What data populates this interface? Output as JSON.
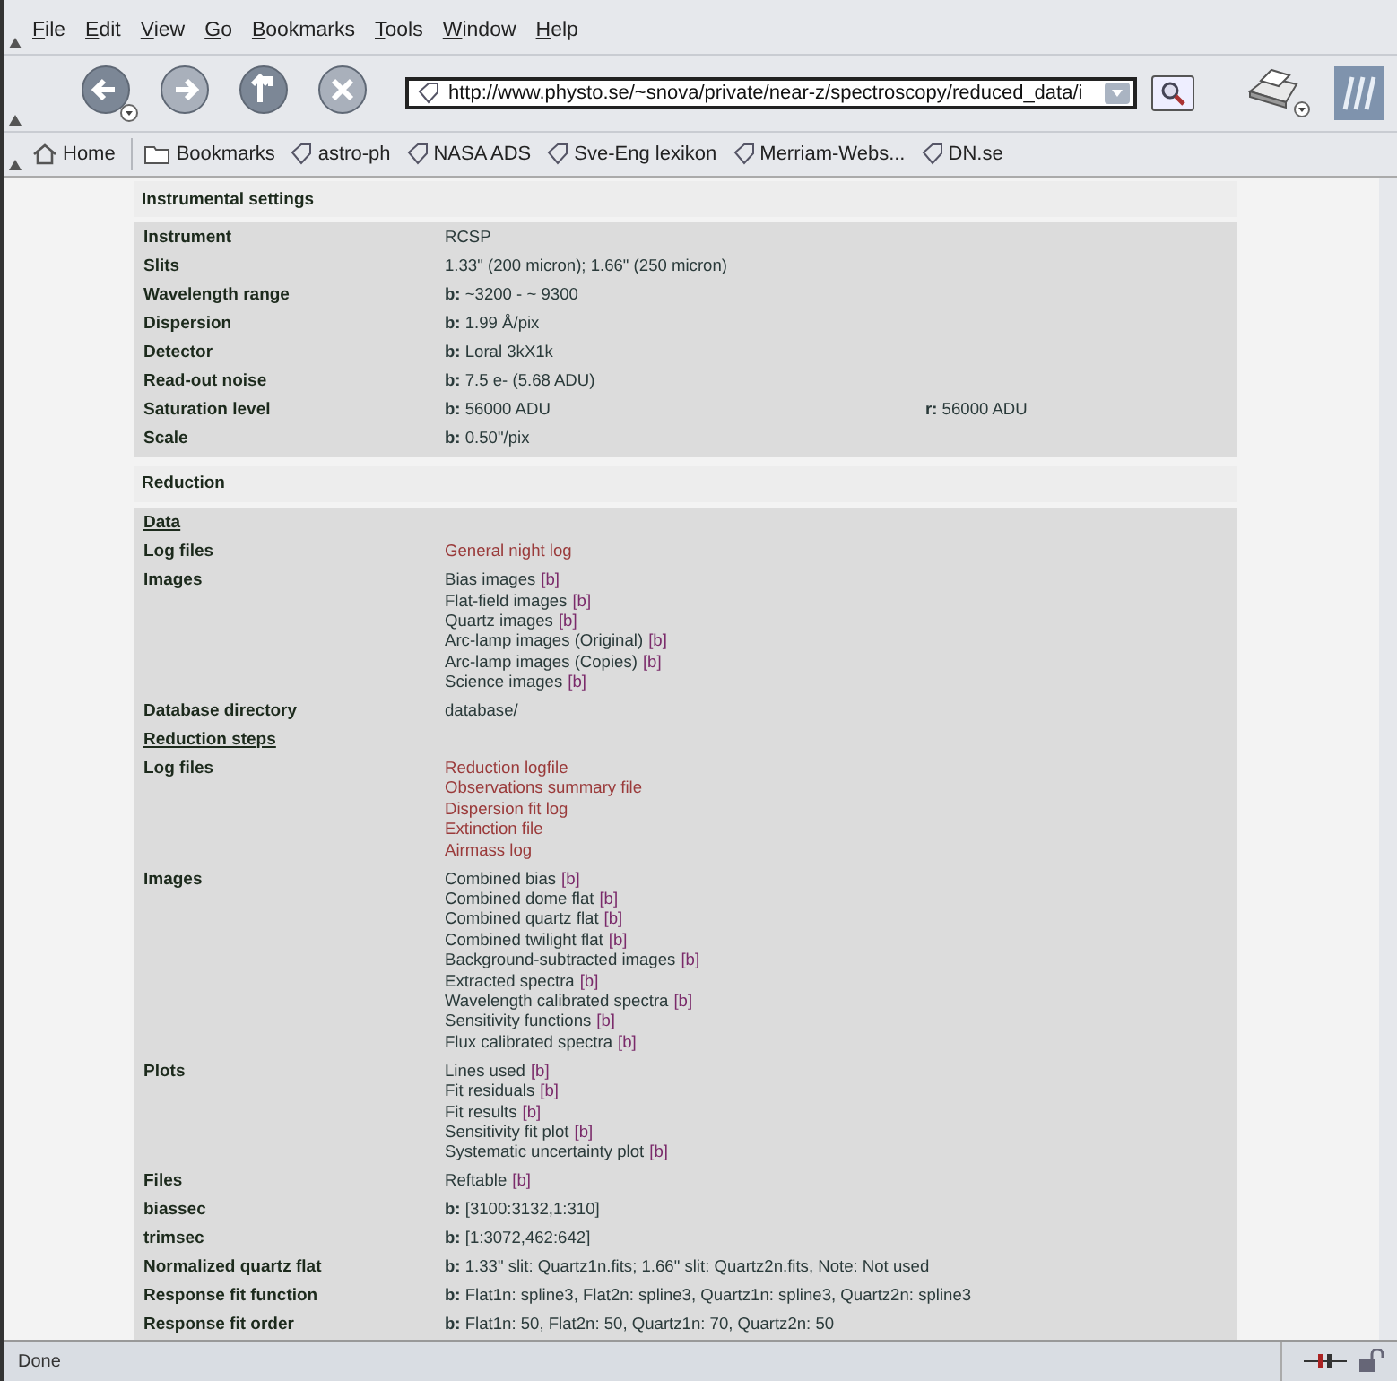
{
  "menu": [
    "File",
    "Edit",
    "View",
    "Go",
    "Bookmarks",
    "Tools",
    "Window",
    "Help"
  ],
  "nav_buttons": [
    {
      "kind": "back",
      "disabled": false
    },
    {
      "kind": "forward",
      "disabled": true
    },
    {
      "kind": "up",
      "disabled": false
    },
    {
      "kind": "stop",
      "disabled": true
    }
  ],
  "address": {
    "value": "http://www.physto.se/~snova/private/near-z/spectroscopy/reduced_data/i"
  },
  "bookmarks": [
    {
      "kind": "home",
      "label": "Home"
    },
    {
      "kind": "folder",
      "label": "Bookmarks"
    },
    {
      "kind": "link",
      "label": "astro-ph"
    },
    {
      "kind": "link",
      "label": "NASA ADS"
    },
    {
      "kind": "link",
      "label": "Sve-Eng lexikon"
    },
    {
      "kind": "link",
      "label": "Merriam-Webs..."
    },
    {
      "kind": "link",
      "label": "DN.se"
    }
  ],
  "sections": [
    {
      "title": "Instrumental settings",
      "rows": [
        {
          "label": "Instrument",
          "heading": false,
          "values": [
            {
              "kind": "text",
              "text": "RCSP"
            }
          ]
        },
        {
          "label": "Slits",
          "heading": false,
          "values": [
            {
              "kind": "text",
              "text": "1.33\" (200 micron); 1.66\" (250 micron)"
            }
          ]
        },
        {
          "label": "Wavelength range",
          "heading": false,
          "values": [
            {
              "kind": "text",
              "text": "**b:** ~3200 - ~ 9300"
            }
          ]
        },
        {
          "label": "Dispersion",
          "heading": false,
          "values": [
            {
              "kind": "text",
              "text": "**b:** 1.99 Å/pix"
            }
          ]
        },
        {
          "label": "Detector",
          "heading": false,
          "values": [
            {
              "kind": "text",
              "text": "**b:** Loral 3kX1k"
            }
          ]
        },
        {
          "label": "Read-out noise",
          "heading": false,
          "values": [
            {
              "kind": "text",
              "text": "**b:** 7.5 e- (5.68 ADU)"
            }
          ]
        },
        {
          "label": "Saturation level",
          "heading": false,
          "values": [
            {
              "kind": "text",
              "text": "**b:** 56000 ADU"
            }
          ],
          "extra": "**r:** 56000 ADU"
        },
        {
          "label": "Scale",
          "heading": false,
          "values": [
            {
              "kind": "text",
              "text": "**b:** 0.50\"/pix"
            }
          ]
        }
      ]
    },
    {
      "title": "Reduction",
      "rows": [
        {
          "label": "Data",
          "heading": true,
          "values": []
        },
        {
          "label": "Log files",
          "heading": false,
          "values": [
            {
              "kind": "link",
              "text": "General night log"
            }
          ]
        },
        {
          "label": "Images",
          "heading": false,
          "values": [
            {
              "kind": "text",
              "text": "Bias images",
              "tag": "[b]"
            },
            {
              "kind": "text",
              "text": "Flat-field images",
              "tag": "[b]"
            },
            {
              "kind": "text",
              "text": "Quartz images",
              "tag": "[b]"
            },
            {
              "kind": "text",
              "text": "Arc-lamp images (Original)",
              "tag": "[b]"
            },
            {
              "kind": "text",
              "text": "Arc-lamp images (Copies)",
              "tag": "[b]"
            },
            {
              "kind": "text",
              "text": "Science images",
              "tag": "[b]"
            }
          ]
        },
        {
          "label": "Database directory",
          "heading": false,
          "values": [
            {
              "kind": "text",
              "text": "database/"
            }
          ]
        },
        {
          "label": "Reduction steps",
          "heading": true,
          "values": []
        },
        {
          "label": "Log files",
          "heading": false,
          "values": [
            {
              "kind": "link",
              "text": "Reduction logfile"
            },
            {
              "kind": "link",
              "text": "Observations summary file"
            },
            {
              "kind": "link",
              "text": "Dispersion fit log"
            },
            {
              "kind": "link",
              "text": "Extinction file"
            },
            {
              "kind": "link",
              "text": "Airmass log"
            }
          ]
        },
        {
          "label": "Images",
          "heading": false,
          "values": [
            {
              "kind": "text",
              "text": "Combined bias",
              "tag": "[b]"
            },
            {
              "kind": "text",
              "text": "Combined dome flat",
              "tag": "[b]"
            },
            {
              "kind": "text",
              "text": "Combined quartz flat",
              "tag": "[b]"
            },
            {
              "kind": "text",
              "text": "Combined twilight flat",
              "tag": "[b]"
            },
            {
              "kind": "text",
              "text": "Background-subtracted images",
              "tag": "[b]"
            },
            {
              "kind": "text",
              "text": "Extracted spectra",
              "tag": "[b]"
            },
            {
              "kind": "text",
              "text": "Wavelength calibrated spectra",
              "tag": "[b]"
            },
            {
              "kind": "text",
              "text": "Sensitivity functions",
              "tag": "[b]"
            },
            {
              "kind": "text",
              "text": "Flux calibrated spectra",
              "tag": "[b]"
            }
          ]
        },
        {
          "label": "Plots",
          "heading": false,
          "values": [
            {
              "kind": "text",
              "text": "Lines used",
              "tag": "[b]"
            },
            {
              "kind": "text",
              "text": "Fit residuals",
              "tag": "[b]"
            },
            {
              "kind": "text",
              "text": "Fit results",
              "tag": "[b]"
            },
            {
              "kind": "text",
              "text": "Sensitivity fit plot",
              "tag": "[b]"
            },
            {
              "kind": "text",
              "text": "Systematic uncertainty plot",
              "tag": "[b]"
            }
          ]
        },
        {
          "label": "Files",
          "heading": false,
          "values": [
            {
              "kind": "text",
              "text": "Reftable",
              "tag": "[b]"
            }
          ]
        },
        {
          "label": "biassec",
          "heading": false,
          "values": [
            {
              "kind": "text",
              "text": "**b:** [3100:3132,1:310]"
            }
          ]
        },
        {
          "label": "trimsec",
          "heading": false,
          "values": [
            {
              "kind": "text",
              "text": "**b:** [1:3072,462:642]"
            }
          ]
        },
        {
          "label": "Normalized quartz flat",
          "heading": false,
          "values": [
            {
              "kind": "text",
              "text": "**b:** 1.33\" slit: Quartz1n.fits; 1.66\" slit: Quartz2n.fits, Note: Not used"
            }
          ]
        },
        {
          "label": "Response fit function",
          "heading": false,
          "values": [
            {
              "kind": "text",
              "text": "**b:** Flat1n: spline3, Flat2n: spline3, Quartz1n: spline3, Quartz2n: spline3"
            }
          ]
        },
        {
          "label": "Response fit order",
          "heading": false,
          "values": [
            {
              "kind": "text",
              "text": "**b:** Flat1n: 50, Flat2n: 50, Quartz1n: 70, Quartz2n: 50"
            }
          ]
        }
      ]
    }
  ],
  "status_bar": {
    "text": "Done"
  }
}
